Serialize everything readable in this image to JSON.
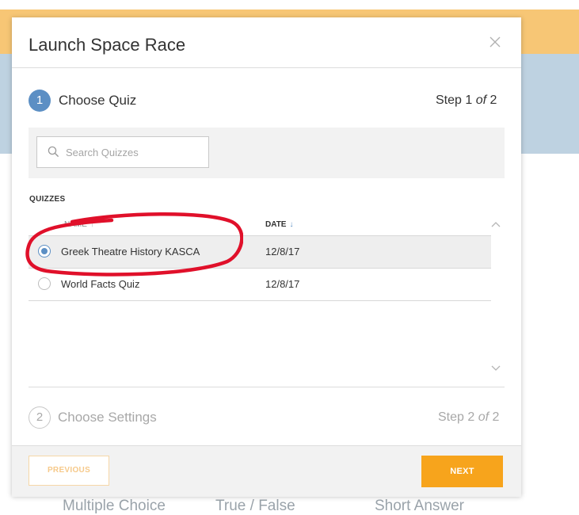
{
  "background": {
    "question_types": [
      "Multiple Choice",
      "True / False",
      "Short Answer"
    ]
  },
  "modal": {
    "title": "Launch Space Race",
    "step1": {
      "number": "1",
      "title": "Choose Quiz",
      "counter_prefix": "Step 1 ",
      "counter_of": "of",
      "counter_suffix": " 2"
    },
    "search": {
      "placeholder": "Search Quizzes",
      "value": ""
    },
    "quizzes_label": "QUIZZES",
    "columns": {
      "name": "NAME",
      "name_sort": "↑",
      "date": "DATE",
      "date_sort": "↓"
    },
    "rows": [
      {
        "name": "Greek Theatre History KASCA",
        "date": "12/8/17",
        "selected": true
      },
      {
        "name": "World Facts Quiz",
        "date": "12/8/17",
        "selected": false
      }
    ],
    "step2": {
      "number": "2",
      "title": "Choose Settings",
      "counter_prefix": "Step 2 ",
      "counter_of": "of",
      "counter_suffix": " 2"
    },
    "buttons": {
      "previous": "PREVIOUS",
      "next": "NEXT"
    }
  },
  "colors": {
    "accent_blue": "#5c8fc4",
    "next_orange": "#f7a41c",
    "annotation_red": "#e0102a",
    "header_orange": "#f7c675",
    "header_blue": "#bed2e1"
  }
}
